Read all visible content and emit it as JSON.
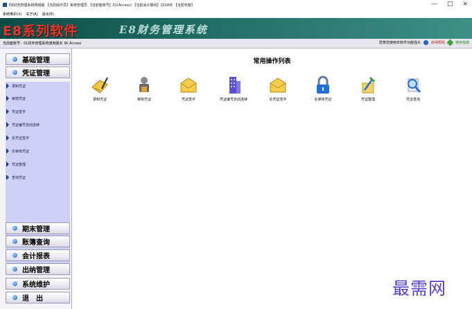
{
  "window": {
    "title": "E8财务管理系统网络版 【当前操作员】系统管理员 【当前套账号】01(Access) 【当前会计期间】2018年 【当前年度】",
    "controls": [
      "—",
      "□",
      "×"
    ]
  },
  "menubar": [
    "系统维护(X)",
    "关于(A)",
    "退出(E)"
  ],
  "banner": {
    "brand": "E8系列软件",
    "system_title": "E8财务管理系统"
  },
  "infobar": {
    "left": "当前套账号：01财务管理系统通用版本 3K Access",
    "right_text": "愿意您使用本软件功能强大",
    "badge1": "获得帮助",
    "badge2": "使用指南"
  },
  "sidebar": {
    "top_categories": [
      "基础管理",
      "凭证管理"
    ],
    "sub_items": [
      "录制凭证",
      "审核凭证",
      "凭证签字",
      "凭证编号自动连续",
      "反凭证签字",
      "反审核凭证",
      "凭证整理",
      "查询凭证"
    ],
    "bottom_categories": [
      "期末管理",
      "账簿查询",
      "会计报表",
      "出纳管理",
      "系统维护",
      "退　出"
    ]
  },
  "main": {
    "title": "常用操作列表",
    "tools": [
      {
        "label": "录制凭证",
        "icon": "pen-paper-icon"
      },
      {
        "label": "审核凭证",
        "icon": "lock-person-icon"
      },
      {
        "label": "凭证签字",
        "icon": "envelope-icon"
      },
      {
        "label": "凭证编号自动连续",
        "icon": "building-icon"
      },
      {
        "label": "反凭证签字",
        "icon": "envelope-icon"
      },
      {
        "label": "反审核凭证",
        "icon": "padlock-icon"
      },
      {
        "label": "凭证整理",
        "icon": "pencil-tools-icon"
      },
      {
        "label": "凭证查询",
        "icon": "magnifier-icon"
      }
    ]
  },
  "watermark": "最需网",
  "colors": {
    "banner": "#1e6b63",
    "brand": "#e23a2c",
    "sidebar_sub": "#cfd0f5",
    "watermark": "#5a3fc8"
  }
}
